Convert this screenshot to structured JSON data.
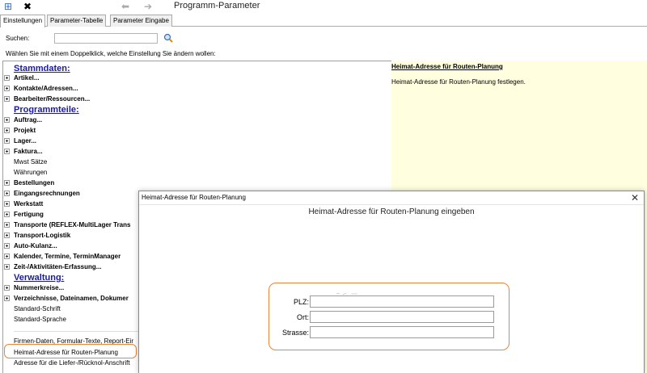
{
  "window": {
    "title": "Programm-Parameter",
    "toolbar_icons": [
      "grid-icon",
      "close-x-icon",
      "arrow-left-icon",
      "arrow-right-icon"
    ]
  },
  "tabs": [
    {
      "label": "Einstellungen",
      "active": true
    },
    {
      "label": "Parameter-Tabelle",
      "active": false
    },
    {
      "label": "Parameter Eingabe",
      "active": false
    }
  ],
  "search": {
    "label": "Suchen:",
    "value": "",
    "placeholder": ""
  },
  "hint": "Wählen Sie mit einem Doppelklick, welche Einstellung Sie ändern wollen:",
  "tree": {
    "items": [
      {
        "type": "section",
        "label": "Stammdaten:"
      },
      {
        "type": "group",
        "label": "Artikel..."
      },
      {
        "type": "group",
        "label": "Kontakte/Adressen..."
      },
      {
        "type": "group",
        "label": "Bearbeiter/Ressourcen..."
      },
      {
        "type": "section",
        "label": "Programmteile:"
      },
      {
        "type": "group",
        "label": "Auftrag..."
      },
      {
        "type": "group",
        "label": "Projekt"
      },
      {
        "type": "group",
        "label": "Lager..."
      },
      {
        "type": "group",
        "label": "Faktura..."
      },
      {
        "type": "leaf",
        "label": "Mwst Sätze"
      },
      {
        "type": "leaf",
        "label": "Währungen"
      },
      {
        "type": "group",
        "label": "Bestellungen"
      },
      {
        "type": "group",
        "label": "Eingangsrechnungen"
      },
      {
        "type": "group",
        "label": "Werkstatt"
      },
      {
        "type": "group",
        "label": "Fertigung"
      },
      {
        "type": "group",
        "label": "Transporte (REFLEX-MultiLager Trans"
      },
      {
        "type": "group",
        "label": "Transport-Logistik"
      },
      {
        "type": "group",
        "label": "Auto-Kulanz..."
      },
      {
        "type": "group",
        "label": "Kalender, Termine, TerminManager"
      },
      {
        "type": "group",
        "label": "Zeit-/Aktivitäten-Erfassung..."
      },
      {
        "type": "section",
        "label": "Verwaltung:"
      },
      {
        "type": "group",
        "label": "Nummerkreise..."
      },
      {
        "type": "group",
        "label": "Verzeichnisse, Dateinamen, Dokumer"
      },
      {
        "type": "leaf",
        "label": "Standard-Schrift"
      },
      {
        "type": "leaf",
        "label": "Standard-Sprache"
      },
      {
        "type": "leaf",
        "label": "Firmen-Daten, Formular-Texte, Report-Eir"
      },
      {
        "type": "leaf",
        "label": "Heimat-Adresse für Routen-Planung",
        "highlighted": true
      },
      {
        "type": "leaf",
        "label": "Adresse für die Liefer-/Rücknol-Anschrift"
      }
    ]
  },
  "info_panel": {
    "title": "Heimat-Adresse für Routen-Planung",
    "description": "Heimat-Adresse für Routen-Planung festlegen."
  },
  "dialog": {
    "title": "Heimat-Adresse für Routen-Planung",
    "heading": "Heimat-Adresse für Routen-Planung eingeben",
    "fields": [
      {
        "label": "PLZ:",
        "value": ""
      },
      {
        "label": "Ort:",
        "value": ""
      },
      {
        "label": "Strasse:",
        "value": ""
      }
    ]
  },
  "colors": {
    "section_link": "#1a1aa6",
    "highlight_outline": "#e8863a",
    "info_background": "#ffffe0"
  }
}
